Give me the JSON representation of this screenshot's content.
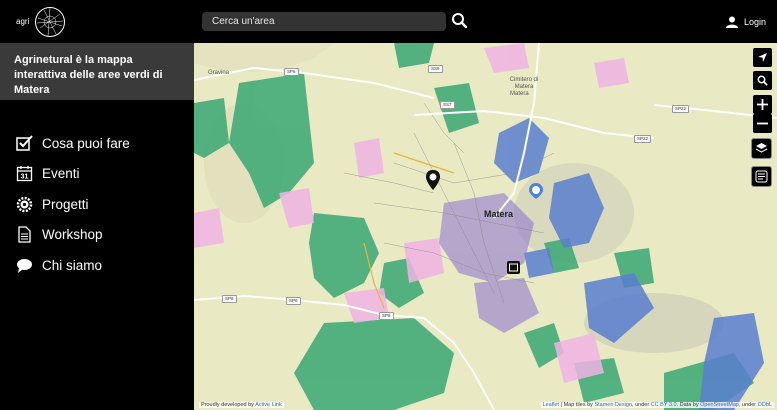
{
  "header": {
    "logo_text": "agri",
    "search_placeholder": "Cerca un'area",
    "login_label": "Login"
  },
  "sidebar": {
    "intro": "Agrinetural è la mappa interattiva delle aree verdi di Matera",
    "items": [
      {
        "label": "Cosa puoi fare",
        "icon": "checkbox-icon"
      },
      {
        "label": "Eventi",
        "icon": "calendar-icon"
      },
      {
        "label": "Progetti",
        "icon": "gears-icon"
      },
      {
        "label": "Workshop",
        "icon": "document-icon"
      },
      {
        "label": "Chi siamo",
        "icon": "chat-icon"
      }
    ]
  },
  "map": {
    "city_label": "Matera",
    "labels": {
      "gravina": "Gravina",
      "cimitero": "Cimitero di Matera",
      "matera_n": "Matera"
    },
    "roads": [
      "SP6",
      "SS7",
      "SS9",
      "SP22",
      "SP22",
      "SP8",
      "SP6",
      "SP8"
    ],
    "attribution_left_prefix": "Proudly developed by ",
    "attribution_left_link": "Active Link",
    "attribution_right_leaflet": "Leaflet",
    "attribution_right_text1": " | Map tiles by ",
    "attribution_right_stamen": "Stamen Design",
    "attribution_right_text2": ", under ",
    "attribution_right_ccby": "CC BY 3.0",
    "attribution_right_text3": ". Data by ",
    "attribution_right_osm": "OpenStreetMap",
    "attribution_right_text4": ", under ",
    "attribution_right_odbl": "ODbL"
  },
  "colors": {
    "green_area": "#3aa874",
    "blue_area": "#5a7fcf",
    "pink_area": "#f0b4e4",
    "purple_area": "#8a6fd1",
    "base_map": "#e9e9c4",
    "sidebar_intro_bg": "#3a3a3a"
  }
}
